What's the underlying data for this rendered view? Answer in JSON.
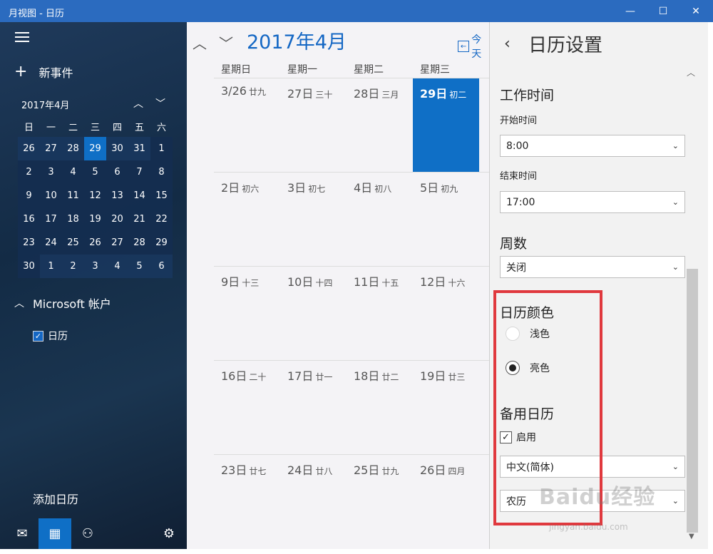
{
  "window": {
    "title": "月视图 - 日历",
    "minimize_glyph": "—",
    "maximize_glyph": "☐",
    "close_glyph": "✕"
  },
  "nav": {
    "new_event_plus": "+",
    "new_event_label": "新事件",
    "mini_calendar": {
      "title": "2017年4月",
      "up_glyph": "︿",
      "down_glyph": "﹀",
      "weekdays": [
        "日",
        "一",
        "二",
        "三",
        "四",
        "五",
        "六"
      ],
      "weeks": [
        [
          "26",
          "27",
          "28",
          "29",
          "30",
          "31",
          "1"
        ],
        [
          "2",
          "3",
          "4",
          "5",
          "6",
          "7",
          "8"
        ],
        [
          "9",
          "10",
          "11",
          "12",
          "13",
          "14",
          "15"
        ],
        [
          "16",
          "17",
          "18",
          "19",
          "20",
          "21",
          "22"
        ],
        [
          "23",
          "24",
          "25",
          "26",
          "27",
          "28",
          "29"
        ],
        [
          "30",
          "1",
          "2",
          "3",
          "4",
          "5",
          "6"
        ]
      ]
    },
    "account_chevron": "︿",
    "account_name": "Microsoft 帐户",
    "calendar_checked": "✓",
    "calendar_name": "日历",
    "add_calendar": "添加日历",
    "icons": {
      "mail": "✉",
      "calendar": "▦",
      "people": "⚇",
      "settings": "⚙"
    }
  },
  "month_view": {
    "up_glyph": "︿",
    "down_glyph": "﹀",
    "title": "2017年4月",
    "today_icon": "←",
    "today_label": "今天",
    "weekdays": [
      "星期日",
      "星期一",
      "星期二",
      "星期三"
    ],
    "weeks": [
      [
        {
          "d": "3/26",
          "l": "廿九"
        },
        {
          "d": "27日",
          "l": "三十"
        },
        {
          "d": "28日",
          "l": "三月"
        },
        {
          "d": "29日",
          "l": "初二"
        }
      ],
      [
        {
          "d": "2日",
          "l": "初六"
        },
        {
          "d": "3日",
          "l": "初七"
        },
        {
          "d": "4日",
          "l": "初八"
        },
        {
          "d": "5日",
          "l": "初九"
        }
      ],
      [
        {
          "d": "9日",
          "l": "十三"
        },
        {
          "d": "10日",
          "l": "十四"
        },
        {
          "d": "11日",
          "l": "十五"
        },
        {
          "d": "12日",
          "l": "十六"
        }
      ],
      [
        {
          "d": "16日",
          "l": "二十"
        },
        {
          "d": "17日",
          "l": "廿一"
        },
        {
          "d": "18日",
          "l": "廿二"
        },
        {
          "d": "19日",
          "l": "廿三"
        }
      ],
      [
        {
          "d": "23日",
          "l": "廿七"
        },
        {
          "d": "24日",
          "l": "廿八"
        },
        {
          "d": "25日",
          "l": "廿九"
        },
        {
          "d": "26日",
          "l": "四月"
        }
      ]
    ],
    "today_accent": "#0f6fc6"
  },
  "settings": {
    "back_glyph": "‹",
    "title": "日历设置",
    "scroll_up_glyph": "︿",
    "scroll_down_glyph": "▼",
    "work_hours_heading": "工作时间",
    "start_time_label": "开始时间",
    "start_time_value": "8:00",
    "end_time_label": "结束时间",
    "end_time_value": "17:00",
    "week_numbers_heading": "周数",
    "week_numbers_value": "关闭",
    "calendar_color_heading": "日历颜色",
    "color_light": "浅色",
    "color_bright": "亮色",
    "alt_calendar_heading": "备用日历",
    "alt_enabled_check": "✓",
    "alt_enabled_label": "启用",
    "alt_language_value": "中文(简体)",
    "alt_type_value": "农历",
    "dropdown_arrow": "⌄",
    "highlight_color": "#e0393e"
  },
  "watermark": {
    "text": "Baidu经验",
    "sub": "jingyan.baidu.com"
  }
}
